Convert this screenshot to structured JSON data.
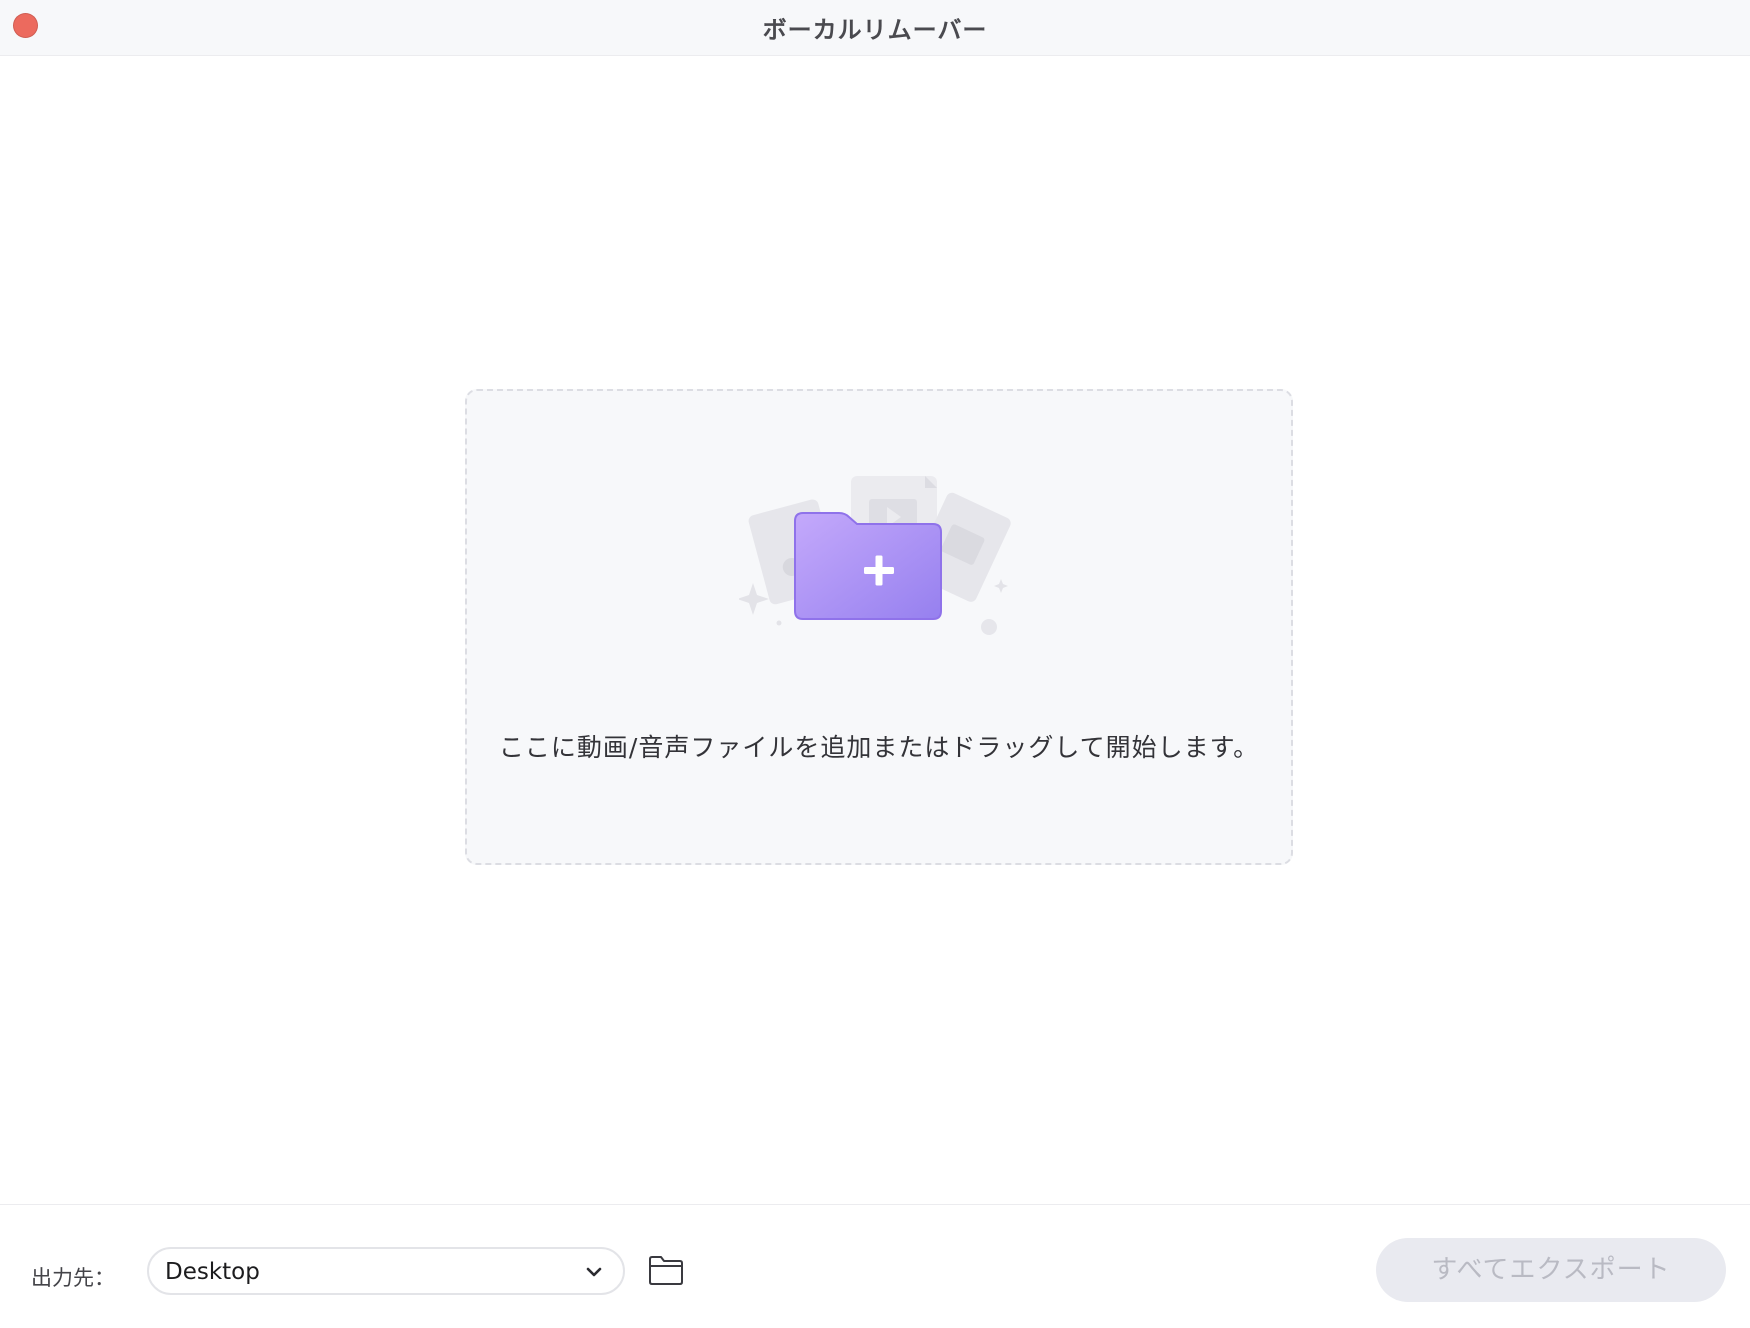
{
  "window": {
    "title": "ボーカルリムーバー"
  },
  "dropzone": {
    "text": "ここに動画/音声ファイルを追加またはドラッグして開始します。"
  },
  "footer": {
    "output_label": "出力先：",
    "destination_value": "Desktop",
    "export_all_label": "すべてエクスポート"
  },
  "colors": {
    "close_button": "#ec6a5e",
    "accent_purple": "#9b7ff0",
    "disabled_button_bg": "#e9eaf0",
    "disabled_button_text": "#b9bac3"
  },
  "icons": [
    "close-icon",
    "add-folder-icon",
    "chevron-down-icon",
    "folder-icon"
  ]
}
